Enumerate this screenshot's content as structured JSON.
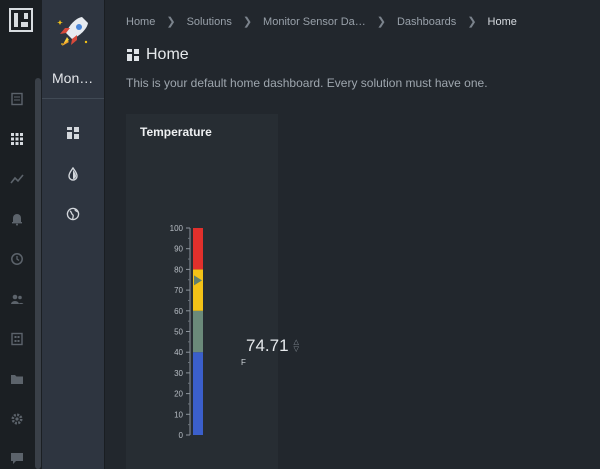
{
  "app": {
    "name": "Mon…"
  },
  "breadcrumbs": [
    {
      "label": "Home"
    },
    {
      "label": "Solutions"
    },
    {
      "label": "Monitor Sensor Da…"
    },
    {
      "label": "Dashboards"
    },
    {
      "label": "Home"
    }
  ],
  "page": {
    "title": "Home",
    "description": "This is your default home dashboard. Every solution must have one."
  },
  "rail_icons": [
    "document-icon",
    "apps-icon",
    "chart-line-icon",
    "bell-icon",
    "refresh-clock-icon",
    "users-icon",
    "building-icon",
    "folder-icon",
    "gear-icon",
    "chat-icon"
  ],
  "panel_icons": [
    "dashboard-icon",
    "drop-icon",
    "globe-icon"
  ],
  "colors": {
    "accent_red": "#e1302c",
    "accent_yellow": "#f3c217",
    "accent_green": "#6b8a7a",
    "accent_blue": "#3b5fcb"
  },
  "widget": {
    "title": "Temperature",
    "value": "74.71",
    "unit": "F"
  },
  "chart_data": {
    "type": "gauge",
    "title": "Temperature",
    "ylim": [
      0,
      100
    ],
    "ticks": [
      0,
      10,
      20,
      30,
      40,
      50,
      60,
      70,
      80,
      90,
      100
    ],
    "value": 74.71,
    "unit": "F",
    "bands": [
      {
        "from": 0,
        "to": 40,
        "color": "#3b5fcb"
      },
      {
        "from": 40,
        "to": 60,
        "color": "#6b8a7a"
      },
      {
        "from": 60,
        "to": 80,
        "color": "#f3c217"
      },
      {
        "from": 80,
        "to": 100,
        "color": "#e1302c"
      }
    ]
  }
}
